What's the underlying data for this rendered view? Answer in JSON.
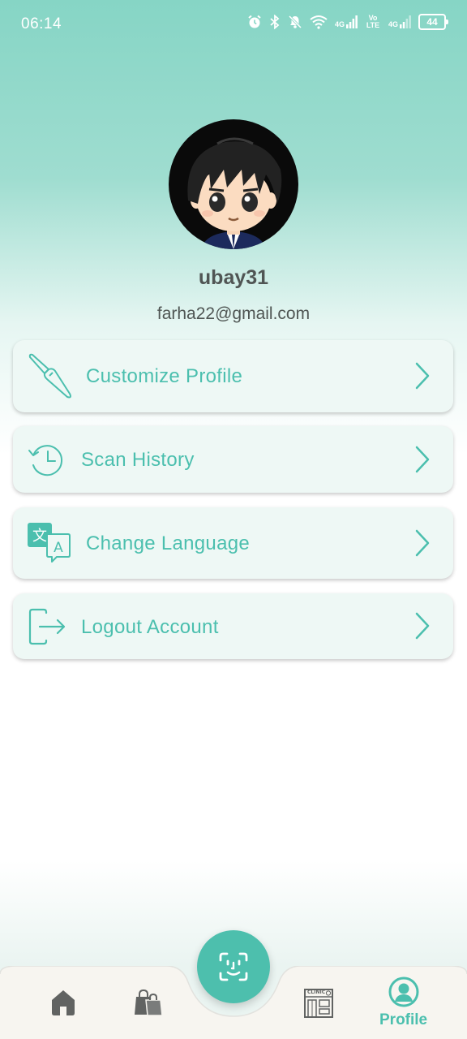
{
  "status_bar": {
    "time": "06:14",
    "net1": "4G",
    "volte": "Vo LTE",
    "net2": "4G",
    "battery": "44"
  },
  "profile": {
    "username": "ubay31",
    "email": "farha22@gmail.com"
  },
  "menu": [
    {
      "label": "Customize Profile",
      "icon": "paintbrush-icon"
    },
    {
      "label": "Scan History",
      "icon": "history-clock-icon"
    },
    {
      "label": "Change Language",
      "icon": "translate-icon"
    },
    {
      "label": "Logout Account",
      "icon": "logout-icon"
    }
  ],
  "bottom_nav": {
    "active_label": "Profile",
    "items": [
      "home-icon",
      "shopping-bags-icon",
      "face-scan-icon",
      "clinic-icon",
      "profile-icon"
    ],
    "clinic_sign": "CLINIC"
  },
  "colors": {
    "accent": "#4bbfae",
    "header_top": "#86d5c5",
    "card_bg": "#eef8f5",
    "text_dark": "#505554"
  }
}
